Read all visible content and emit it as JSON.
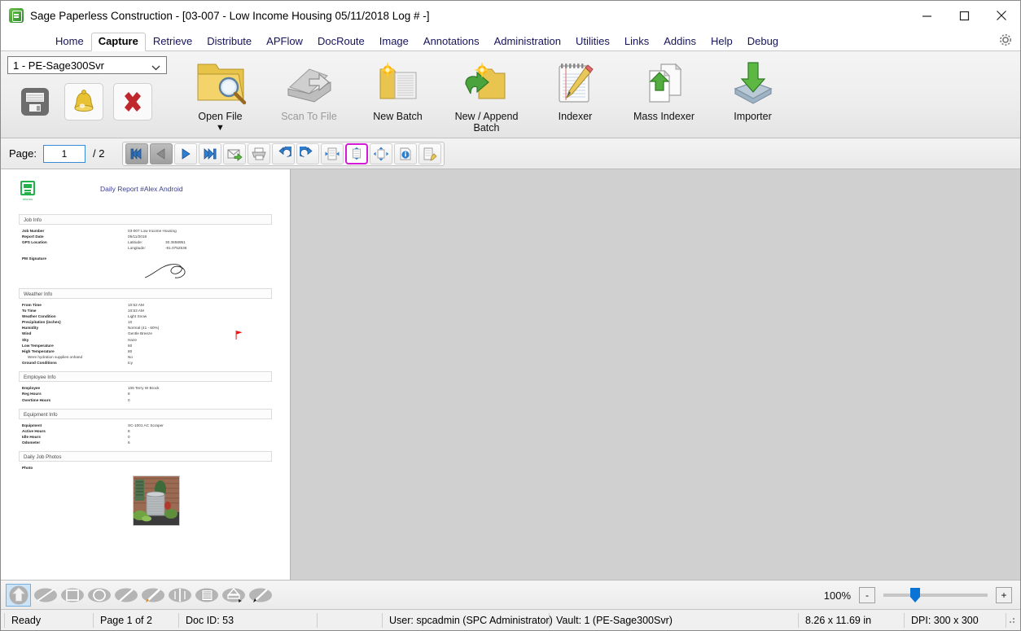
{
  "window": {
    "title": "Sage Paperless Construction - [03-007 - Low Income Housing 05/11/2018 Log # -]",
    "app_icon": "sage-paperless-icon",
    "minimize": "minimize-icon",
    "maximize": "maximize-icon",
    "close": "close-icon"
  },
  "menu": {
    "items": [
      {
        "label": "Home",
        "active": false
      },
      {
        "label": "Capture",
        "active": true
      },
      {
        "label": "Retrieve",
        "active": false
      },
      {
        "label": "Distribute",
        "active": false
      },
      {
        "label": "APFlow",
        "active": false
      },
      {
        "label": "DocRoute",
        "active": false
      },
      {
        "label": "Image",
        "active": false
      },
      {
        "label": "Annotations",
        "active": false
      },
      {
        "label": "Administration",
        "active": false
      },
      {
        "label": "Utilities",
        "active": false
      },
      {
        "label": "Links",
        "active": false
      },
      {
        "label": "Addins",
        "active": false
      },
      {
        "label": "Help",
        "active": false
      },
      {
        "label": "Debug",
        "active": false
      }
    ],
    "settings_icon": "gear-icon"
  },
  "ribbon": {
    "vault_value": "1 - PE-Sage300Svr",
    "vault_options": [
      "1 - PE-Sage300Svr"
    ],
    "small_buttons": [
      {
        "name": "save-button",
        "icon": "floppy-disk-icon"
      },
      {
        "name": "alerts-button",
        "icon": "bell-icon"
      },
      {
        "name": "delete-button",
        "icon": "red-x-icon"
      }
    ],
    "big_buttons": [
      {
        "label": "Open File",
        "icon": "folder-search-icon",
        "disabled": false,
        "has_dropdown": true
      },
      {
        "label": "Scan To File",
        "icon": "scanner-icon",
        "disabled": true,
        "has_dropdown": false
      },
      {
        "label": "New Batch",
        "icon": "new-batch-folder-icon",
        "disabled": false,
        "has_dropdown": false
      },
      {
        "label": "New / Append\nBatch",
        "line1": "New / Append",
        "line2": "Batch",
        "icon": "append-batch-folder-icon",
        "disabled": false,
        "has_dropdown": false
      },
      {
        "label": "Indexer",
        "icon": "notepad-pencil-icon",
        "disabled": false,
        "has_dropdown": false
      },
      {
        "label": "Mass Indexer",
        "icon": "documents-upload-icon",
        "disabled": false,
        "has_dropdown": false
      },
      {
        "label": "Importer",
        "icon": "import-tray-icon",
        "disabled": false,
        "has_dropdown": false
      }
    ]
  },
  "pagenav": {
    "label": "Page:",
    "current_page": "1",
    "total": "/ 2",
    "buttons": [
      {
        "name": "first-page-button",
        "icon": "first-page-icon",
        "state": "pressed"
      },
      {
        "name": "previous-page-button",
        "icon": "previous-page-icon",
        "state": "pressed"
      },
      {
        "name": "next-page-button",
        "icon": "next-page-icon",
        "state": "normal"
      },
      {
        "name": "last-page-button",
        "icon": "last-page-icon",
        "state": "normal"
      },
      {
        "name": "email-document-button",
        "icon": "envelope-send-icon",
        "state": "normal"
      },
      {
        "name": "print-document-button",
        "icon": "printer-icon",
        "state": "normal"
      },
      {
        "name": "rotate-left-button",
        "icon": "rotate-counterclockwise-icon",
        "state": "normal"
      },
      {
        "name": "rotate-right-button",
        "icon": "rotate-clockwise-icon",
        "state": "normal"
      },
      {
        "name": "fit-width-button",
        "icon": "fit-width-icon",
        "state": "normal"
      },
      {
        "name": "fit-height-button",
        "icon": "fit-height-icon",
        "state": "selected"
      },
      {
        "name": "fit-page-button",
        "icon": "fit-page-icon",
        "state": "normal"
      },
      {
        "name": "document-info-button",
        "icon": "info-icon",
        "state": "normal"
      },
      {
        "name": "edit-document-button",
        "icon": "document-edit-icon",
        "state": "normal"
      }
    ]
  },
  "document": {
    "logo_caption": "eforms",
    "title": "Daily Report #Alex Android",
    "sections": [
      {
        "heading": "Job Info",
        "rows": [
          {
            "key": "Job Number",
            "value": "03-007 Low Income Housing"
          },
          {
            "key": "Report Date",
            "value": "05/11/2018"
          },
          {
            "key": "GPS Location",
            "value": "Latitude:",
            "value2": "30.3658951"
          },
          {
            "key": "",
            "value": "Longitude:",
            "value2": "-91.0752536"
          },
          {
            "key": "PM Signature",
            "value": ""
          }
        ]
      },
      {
        "heading": "Weather Info",
        "rows": [
          {
            "key": "From Time",
            "value": "10:52 AM"
          },
          {
            "key": "To Time",
            "value": "10:53 AM"
          },
          {
            "key": "Weather Condition",
            "value": "Light Snow"
          },
          {
            "key": "Precipitation (inches)",
            "value": "10"
          },
          {
            "key": "Humidity",
            "value": "Normal (41 - 60%)"
          },
          {
            "key": "Wind",
            "value": "Gentle Breeze"
          },
          {
            "key": "Sky",
            "value": "Haze"
          },
          {
            "key": "Low Temperature",
            "value": "60"
          },
          {
            "key": "High Temperature",
            "value": "80"
          },
          {
            "key": "Were hydration supplies onhand",
            "value": "No",
            "sub": true
          },
          {
            "key": "Ground Conditions",
            "value": "Icy"
          }
        ]
      },
      {
        "heading": "Employee Info",
        "rows": [
          {
            "key": "Employee",
            "value": "106 Terry W Brock"
          },
          {
            "key": "Reg Hours",
            "value": "8"
          },
          {
            "key": "Overtime Hours",
            "value": "0"
          }
        ]
      },
      {
        "heading": "Equipment Info",
        "rows": [
          {
            "key": "Equipment",
            "value": "SC-1001 AC Scraper"
          },
          {
            "key": "Active Hours",
            "value": "8"
          },
          {
            "key": "Idle Hours",
            "value": "0"
          },
          {
            "key": "Odometer",
            "value": "6"
          }
        ]
      },
      {
        "heading": "Daily Job Photos",
        "rows": [
          {
            "key": "Photo",
            "value": ""
          }
        ]
      }
    ],
    "annotation_flag": "red-flag-icon",
    "photo_alt": "outdoor-ac-condenser-photo"
  },
  "annotations": {
    "tools": [
      {
        "name": "pointer-home-tool",
        "icon": "up-arrow-home-icon",
        "selected": true
      },
      {
        "name": "line-tool",
        "icon": "line-icon",
        "selected": false
      },
      {
        "name": "rectangle-tool",
        "icon": "rectangle-icon",
        "selected": false
      },
      {
        "name": "ellipse-tool",
        "icon": "ellipse-icon",
        "selected": false
      },
      {
        "name": "pencil-tool",
        "icon": "pencil-icon",
        "selected": false
      },
      {
        "name": "highlighter-tool",
        "icon": "highlighter-icon",
        "selected": false
      },
      {
        "name": "redaction-tool",
        "icon": "redaction-icon",
        "selected": false
      },
      {
        "name": "text-note-tool",
        "icon": "text-lines-icon",
        "selected": false
      },
      {
        "name": "stamp-tool",
        "icon": "stamp-icon",
        "selected": false
      },
      {
        "name": "pen-color-tool",
        "icon": "pen-color-icon",
        "selected": false
      }
    ]
  },
  "zoom": {
    "percent": "100%",
    "decrease_label": "-",
    "increase_label": "+"
  },
  "status": {
    "ready": "Ready",
    "page": "Page 1 of 2",
    "doc_id": "Doc ID: 53",
    "spacer": "",
    "user": "User: spcadmin (SPC Administrator)",
    "vault": "Vault: 1 (PE-Sage300Svr)",
    "size": "8.26 x 11.69 in",
    "dpi": "DPI: 300 x 300"
  }
}
